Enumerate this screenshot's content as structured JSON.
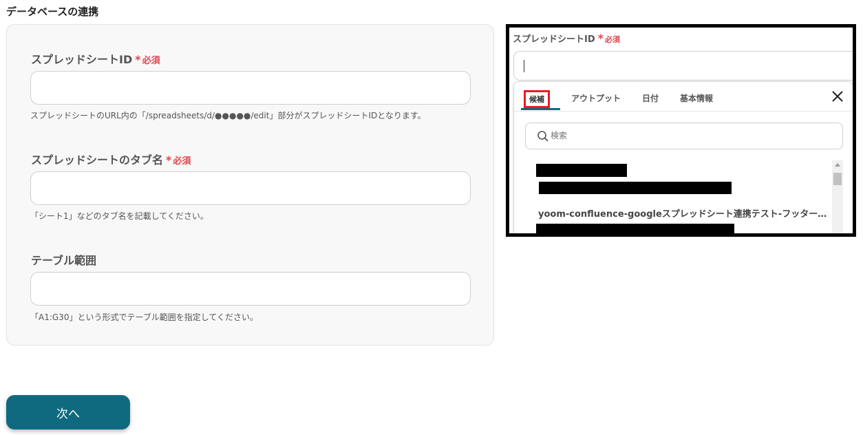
{
  "section_title": "データベースの連携",
  "form": {
    "fields": [
      {
        "label": "スプレッドシートID",
        "required_star": "*",
        "required_text": "必須",
        "value": "",
        "help": "スプレッドシートのURL内の「/spreadsheets/d/●●●●●/edit」部分がスプレッドシートIDとなります。"
      },
      {
        "label": "スプレッドシートのタブ名",
        "required_star": "*",
        "required_text": "必須",
        "value": "",
        "help": "「シート1」などのタブ名を記載してください。"
      },
      {
        "label": "テーブル範囲",
        "value": "",
        "help": "「A1:G30」という形式でテーブル範囲を指定してください。"
      }
    ]
  },
  "next_button": "次へ",
  "popup": {
    "label": "スプレッドシートID",
    "required_star": "*",
    "required_text": "必須",
    "tabs": [
      "候補",
      "アウトプット",
      "日付",
      "基本情報"
    ],
    "search_placeholder": "検索",
    "result_text": "yoom-confluence-googleスプレッドシート連携テスト-フッターコ...",
    "icons": {
      "close": "close-icon",
      "search": "search-icon"
    }
  },
  "colors": {
    "accent": "#0f6a7f",
    "required": "#e0454f",
    "highlight": "#e41e26"
  }
}
